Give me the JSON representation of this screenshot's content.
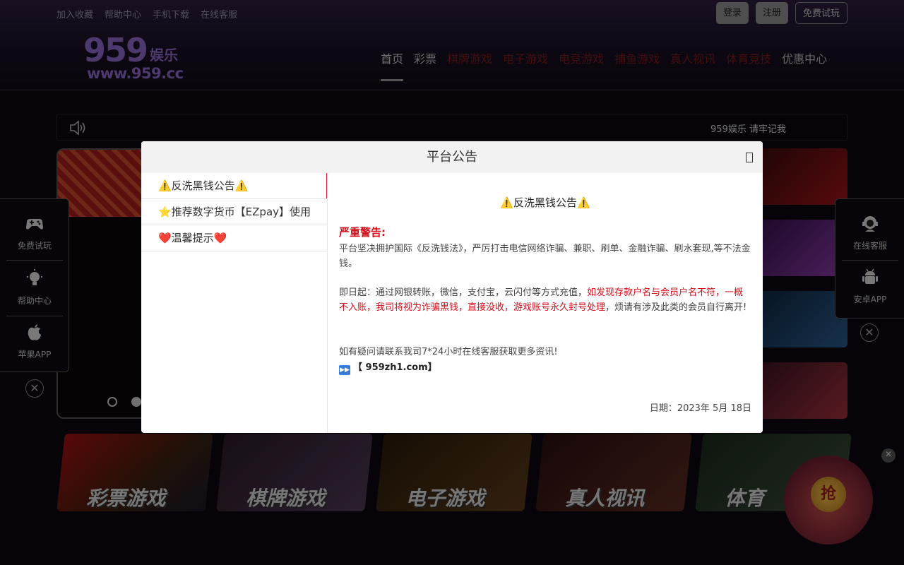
{
  "topbar": {
    "links": [
      "加入收藏",
      "帮助中心",
      "手机下载",
      "在线客服"
    ],
    "login": "登录",
    "register": "注册",
    "trial": "免费试玩"
  },
  "logo": {
    "number": "959",
    "name": "娱乐",
    "url": "www.959.cc"
  },
  "nav": [
    "首页",
    "彩票",
    "棋牌游戏",
    "电子游戏",
    "电竞游戏",
    "捕鱼游戏",
    "真人视讯",
    "体育竞技",
    "优惠中心"
  ],
  "ticker": {
    "text": "959娱乐 请牢记我"
  },
  "categories": [
    "彩票游戏",
    "棋牌游戏",
    "电子游戏",
    "真人视讯",
    "体育"
  ],
  "side_left": [
    "免费试玩",
    "帮助中心",
    "苹果APP"
  ],
  "side_right": [
    "在线客服",
    "安卓APP"
  ],
  "redpacket": {
    "label": "抢"
  },
  "modal": {
    "title": "平台公告",
    "tabs": [
      "⚠️反洗黑钱公告⚠️",
      "⭐推荐数字货币【EZpay】使用",
      "❤️温馨提示❤️"
    ],
    "body": {
      "title": "⚠️反洗黑钱公告⚠️",
      "warn": "严重警告:",
      "p1": "平台坚决拥护国际《反洗钱法》，严厉打击电信网络诈骗、兼职、刷单、金融诈骗、刷水套现,等不法金钱。",
      "p2a": "即日起：通过网银转账，微信，支付宝，云闪付等方式充值，",
      "p2b": "如发现存款户名与会员户名不符，一概不入账，我司将视为诈骗黑钱，直接没收，游戏账号永久封号处理",
      "p2c": "，烦请有涉及此类的会员自行离开!",
      "p3": "如有疑问请联系我司7*24小时在线客服获取更多资讯!",
      "link": "【 959zh1.com】",
      "date": "日期：2023年 5月 18日"
    }
  }
}
